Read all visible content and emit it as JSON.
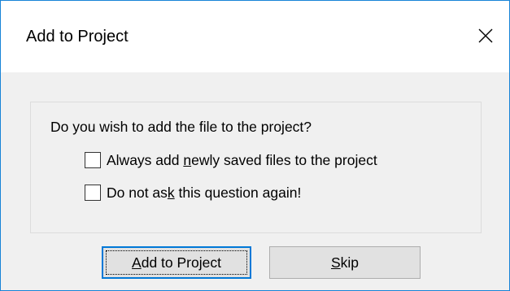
{
  "dialog": {
    "title": "Add to Project",
    "close_label": "×"
  },
  "content": {
    "question": "Do you wish to add the file to the project?",
    "checkboxes": [
      {
        "pre": "Always add ",
        "mnemonic": "n",
        "post": "ewly saved files to the project",
        "checked": false
      },
      {
        "pre": "Do not as",
        "mnemonic": "k",
        "post": " this question again!",
        "checked": false
      }
    ]
  },
  "buttons": {
    "add": {
      "mnemonic": "A",
      "rest": "dd to Project"
    },
    "skip": {
      "mnemonic": "S",
      "rest": "kip"
    }
  },
  "colors": {
    "accent": "#0078d7",
    "window_border": "#1883d7",
    "dialog_bg": "#f0f0f0",
    "button_bg": "#e1e1e1"
  }
}
